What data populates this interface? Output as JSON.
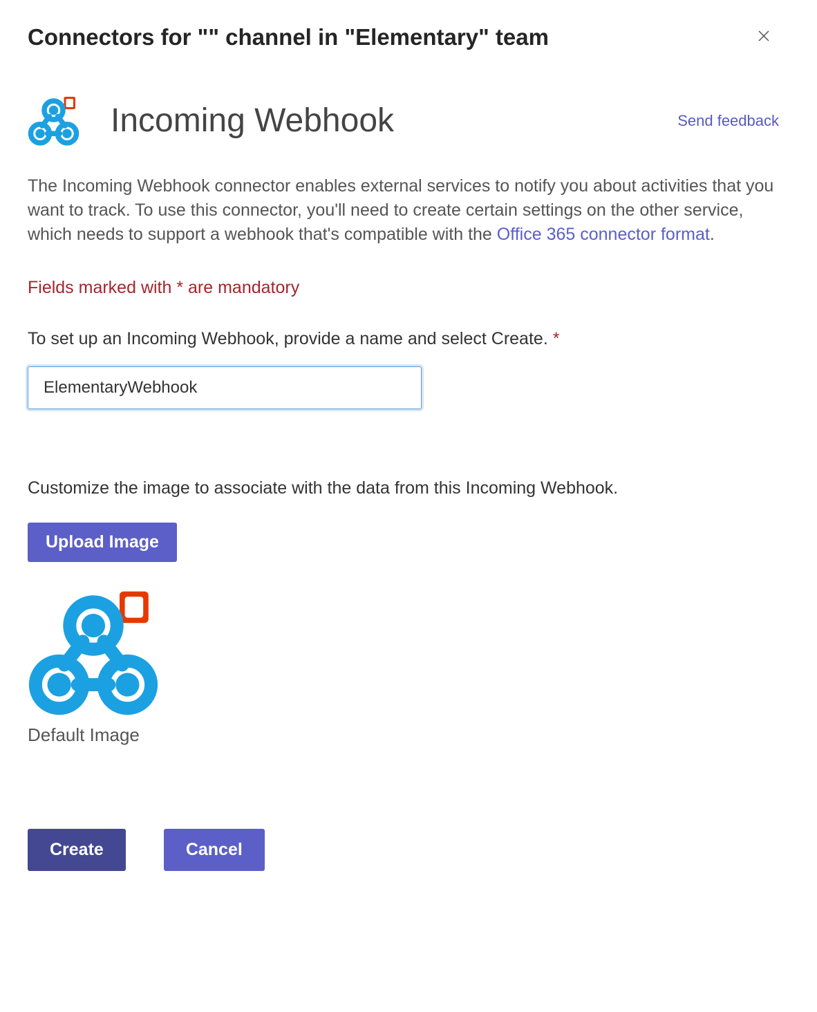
{
  "modal": {
    "title": "Connectors for \"\" channel in \"Elementary\" team"
  },
  "connector": {
    "name": "Incoming Webhook",
    "feedback_link": "Send feedback"
  },
  "description": {
    "text_before_link": "The Incoming Webhook connector enables external services to notify you about activities that you want to track. To use this connector, you'll need to create certain settings on the other service, which needs to support a webhook that's compatible with the ",
    "link_text": "Office 365 connector format",
    "text_after_link": "."
  },
  "mandatory_note": "Fields marked with * are mandatory",
  "setup": {
    "label": "To set up an Incoming Webhook, provide a name and select Create. ",
    "input_value": "ElementaryWebhook"
  },
  "customize": {
    "text": "Customize the image to associate with the data from this Incoming Webhook.",
    "upload_label": "Upload Image",
    "default_image_label": "Default Image"
  },
  "actions": {
    "create": "Create",
    "cancel": "Cancel"
  }
}
